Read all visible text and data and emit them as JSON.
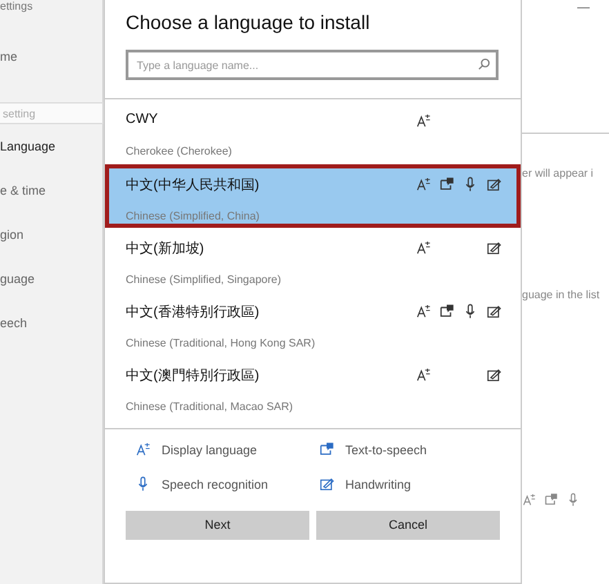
{
  "background": {
    "sidebar": [
      {
        "kind": "header",
        "text": "ettings"
      },
      {
        "kind": "item",
        "text": "me",
        "selected": false
      },
      {
        "kind": "search",
        "placeholder": "setting"
      },
      {
        "kind": "item",
        "text": "Language",
        "selected": true
      },
      {
        "kind": "item",
        "text": "e & time",
        "selected": false
      },
      {
        "kind": "item",
        "text": "gion",
        "selected": false
      },
      {
        "kind": "item",
        "text": "guage",
        "selected": false
      },
      {
        "kind": "item",
        "text": "eech",
        "selected": false
      }
    ],
    "minimize": "—",
    "notes": [
      "er will appear i",
      "guage in the list"
    ]
  },
  "dialog": {
    "title": "Choose a language to install",
    "search": {
      "placeholder": "Type a language name..."
    },
    "languages": [
      {
        "name": "CWY",
        "description": "Cherokee (Cherokee)",
        "selected": false,
        "features": {
          "display": true,
          "tts": false,
          "speech": false,
          "handwriting": false
        }
      },
      {
        "name": "中文(中华人民共和国)",
        "description": "Chinese (Simplified, China)",
        "selected": true,
        "features": {
          "display": true,
          "tts": true,
          "speech": true,
          "handwriting": true
        }
      },
      {
        "name": "中文(新加坡)",
        "description": "Chinese (Simplified, Singapore)",
        "selected": false,
        "features": {
          "display": true,
          "tts": false,
          "speech": false,
          "handwriting": true
        }
      },
      {
        "name": "中文(香港特别行政區)",
        "description": "Chinese (Traditional, Hong Kong SAR)",
        "selected": false,
        "features": {
          "display": true,
          "tts": true,
          "speech": true,
          "handwriting": true
        }
      },
      {
        "name": "中文(澳門特別行政區)",
        "description": "Chinese (Traditional, Macao SAR)",
        "selected": false,
        "features": {
          "display": true,
          "tts": false,
          "speech": false,
          "handwriting": true
        }
      }
    ],
    "legend": [
      {
        "kind": "display",
        "label": "Display language"
      },
      {
        "kind": "tts",
        "label": "Text-to-speech"
      },
      {
        "kind": "speech",
        "label": "Speech recognition"
      },
      {
        "kind": "handwriting",
        "label": "Handwriting"
      }
    ],
    "buttons": [
      "Next",
      "Cancel"
    ]
  }
}
